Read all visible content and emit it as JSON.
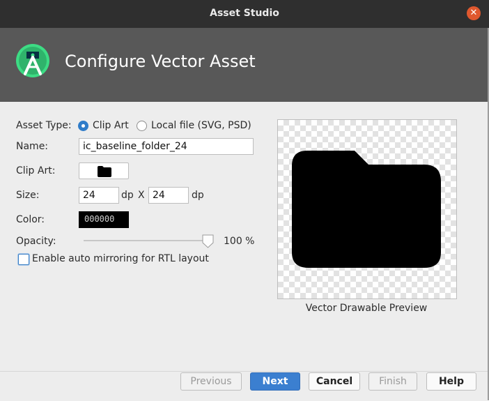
{
  "window": {
    "title": "Asset Studio",
    "close_icon": "close-icon",
    "colors": {
      "titlebar": "#2f2f2f",
      "banner": "#585858",
      "close": "#e0582e",
      "accent": "#3b7fd0"
    }
  },
  "banner": {
    "logo_icon": "android-studio-logo",
    "heading": "Configure Vector Asset"
  },
  "form": {
    "asset_type_label": "Asset Type:",
    "asset_type_options": [
      {
        "label": "Clip Art",
        "selected": true
      },
      {
        "label": "Local file (SVG, PSD)",
        "selected": false
      }
    ],
    "name_label": "Name:",
    "name_value": "ic_baseline_folder_24",
    "clip_art_label": "Clip Art:",
    "clip_art_icon": "folder-icon",
    "size_label": "Size:",
    "size_width": "24",
    "size_unit_1": "dp",
    "size_x": "X",
    "size_height": "24",
    "size_unit_2": "dp",
    "color_label": "Color:",
    "color_value": "000000",
    "opacity_label": "Opacity:",
    "opacity_value": "100 %",
    "opacity_level": 1.0,
    "rtl_label": "Enable auto mirroring for RTL layout",
    "rtl_checked": false
  },
  "preview": {
    "caption": "Vector Drawable Preview",
    "icon": "folder-icon"
  },
  "footer": {
    "previous": "Previous",
    "next": "Next",
    "cancel": "Cancel",
    "finish": "Finish",
    "help": "Help"
  }
}
